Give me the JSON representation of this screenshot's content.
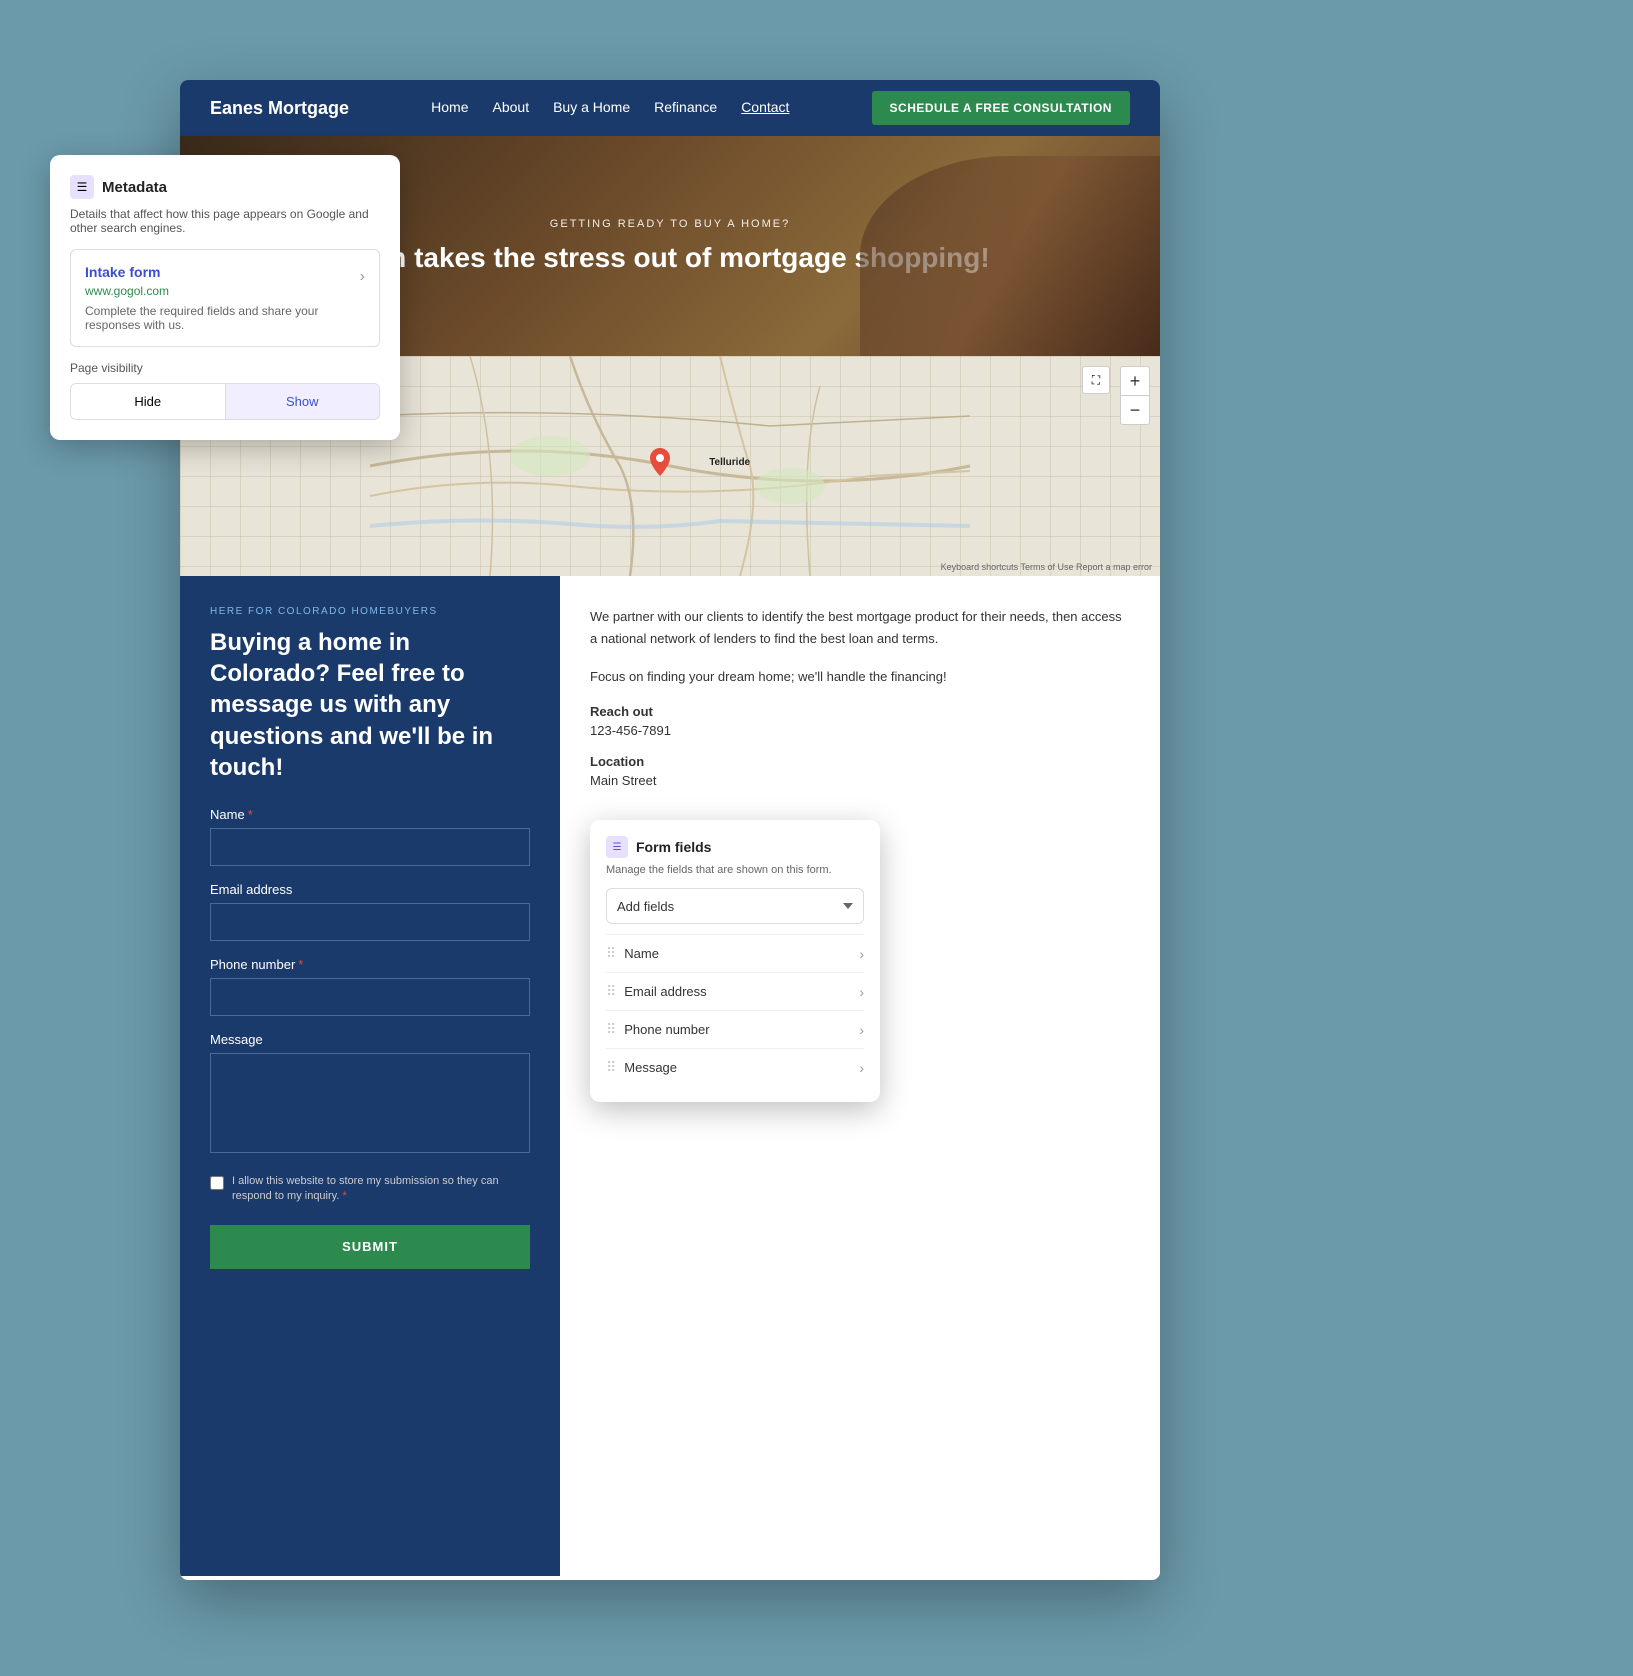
{
  "background": {
    "color": "#6b9aaa"
  },
  "navbar": {
    "brand": "Eanes Mortgage",
    "links": [
      "Home",
      "About",
      "Buy a Home",
      "Refinance",
      "Contact"
    ],
    "active_link": "Contact",
    "cta_label": "SCHEDULE A FREE CONSULTATION"
  },
  "hero": {
    "subtitle": "GETTING READY TO BUY A HOME?",
    "title": "eam takes the stress out of mortgage shopping!"
  },
  "map": {
    "town_label": "Telluride",
    "zoom_in": "+",
    "zoom_out": "−",
    "attribution": "Keyboard shortcuts   Terms of Use   Report a map error"
  },
  "form": {
    "tagline": "HERE FOR COLORADO HOMEBUYERS",
    "heading": "Buying a home in Colorado? Feel free to message us with any questions and we'll be in touch!",
    "name_label": "Name",
    "email_label": "Email address",
    "phone_label": "Phone number",
    "message_label": "Message",
    "checkbox_text": "I allow this website to store my submission so they can respond to my inquiry.",
    "submit_label": "SUBMIT"
  },
  "info": {
    "paragraph1": "We partner with our clients to identify the best mortgage product for their needs, then access a national network of lenders to find the best loan and terms.",
    "paragraph2": "Focus on finding your dream home; we'll handle the financing!",
    "reach_out_label": "Reach out",
    "phone": "123-456-7891",
    "location_label": "Location",
    "location_value": "Main Street"
  },
  "metadata_panel": {
    "title": "Metadata",
    "description": "Details that affect how this page appears on Google and other search engines.",
    "card": {
      "title": "Intake form",
      "url": "www.gogol.com",
      "description": "Complete the required fields and share your responses with us."
    },
    "visibility_label": "Page visibility",
    "hide_label": "Hide",
    "show_label": "Show"
  },
  "form_fields_panel": {
    "title": "Form fields",
    "description": "Manage the fields that are shown on this form.",
    "add_fields_placeholder": "Add fields",
    "fields": [
      {
        "name": "Name"
      },
      {
        "name": "Email address"
      },
      {
        "name": "Phone number"
      },
      {
        "name": "Message"
      }
    ]
  }
}
